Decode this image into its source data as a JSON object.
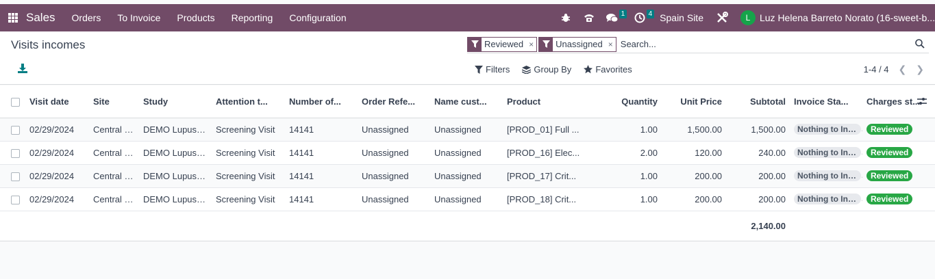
{
  "navbar": {
    "app_name": "Sales",
    "menu": [
      "Orders",
      "To Invoice",
      "Products",
      "Reporting",
      "Configuration"
    ],
    "messages_count": "1",
    "activities_count": "4",
    "site": "Spain Site",
    "avatar_letter": "L",
    "user_name": "Luz Helena Barreto Norato (16-sweet-b...",
    "color": "#714b67"
  },
  "page": {
    "title": "Visits incomes"
  },
  "search": {
    "facets": [
      "Reviewed",
      "Unassigned"
    ],
    "placeholder": "Search..."
  },
  "filters": {
    "filters_label": "Filters",
    "group_by_label": "Group By",
    "favorites_label": "Favorites"
  },
  "pager": {
    "text": "1-4 / 4"
  },
  "table": {
    "columns": [
      "Visit date",
      "Site",
      "Study",
      "Attention t...",
      "Number of...",
      "Order Refe...",
      "Name cust...",
      "Product",
      "Quantity",
      "Unit Price",
      "Subtotal",
      "Invoice Sta...",
      "Charges st..."
    ],
    "rows": [
      {
        "visit_date": "02/29/2024",
        "site": "Central Si...",
        "study": "DEMO Lupus C...",
        "attention": "Screening Visit",
        "number": "14141",
        "order_ref": "Unassigned",
        "name_cust": "Unassigned",
        "product": "[PROD_01] Full ...",
        "quantity": "1.00",
        "unit_price": "1,500.00",
        "subtotal": "1,500.00",
        "invoice_status": "Nothing to Inv...",
        "charges_status": "Reviewed"
      },
      {
        "visit_date": "02/29/2024",
        "site": "Central Si...",
        "study": "DEMO Lupus C...",
        "attention": "Screening Visit",
        "number": "14141",
        "order_ref": "Unassigned",
        "name_cust": "Unassigned",
        "product": "[PROD_16] Elec...",
        "quantity": "2.00",
        "unit_price": "120.00",
        "subtotal": "240.00",
        "invoice_status": "Nothing to Inv...",
        "charges_status": "Reviewed"
      },
      {
        "visit_date": "02/29/2024",
        "site": "Central Si...",
        "study": "DEMO Lupus C...",
        "attention": "Screening Visit",
        "number": "14141",
        "order_ref": "Unassigned",
        "name_cust": "Unassigned",
        "product": "[PROD_17] Crit...",
        "quantity": "1.00",
        "unit_price": "200.00",
        "subtotal": "200.00",
        "invoice_status": "Nothing to Inv...",
        "charges_status": "Reviewed"
      },
      {
        "visit_date": "02/29/2024",
        "site": "Central Si...",
        "study": "DEMO Lupus C...",
        "attention": "Screening Visit",
        "number": "14141",
        "order_ref": "Unassigned",
        "name_cust": "Unassigned",
        "product": "[PROD_18] Crit...",
        "quantity": "1.00",
        "unit_price": "200.00",
        "subtotal": "200.00",
        "invoice_status": "Nothing to Inv...",
        "charges_status": "Reviewed"
      }
    ],
    "total_subtotal": "2,140.00"
  }
}
